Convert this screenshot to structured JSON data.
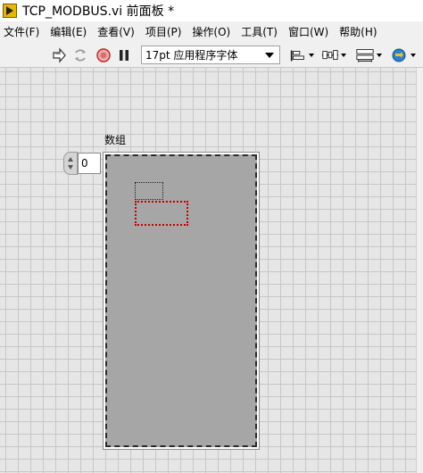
{
  "window": {
    "title": "TCP_MODBUS.vi 前面板 *"
  },
  "menu": [
    {
      "label": "文件(F)"
    },
    {
      "label": "编辑(E)"
    },
    {
      "label": "查看(V)"
    },
    {
      "label": "项目(P)"
    },
    {
      "label": "操作(O)"
    },
    {
      "label": "工具(T)"
    },
    {
      "label": "窗口(W)"
    },
    {
      "label": "帮助(H)"
    }
  ],
  "toolbar": {
    "font": "17pt 应用程序字体",
    "icons": [
      "run-arrow-icon",
      "continuous-run-icon",
      "abort-icon",
      "pause-icon",
      "align-objects-icon",
      "distribute-objects-icon",
      "resize-objects-icon",
      "reorder-icon"
    ],
    "colors": {
      "abort": "#c02020",
      "reorder": "#2d7fd0"
    }
  },
  "panel": {
    "array": {
      "label": "数组",
      "index_value": "0"
    }
  }
}
